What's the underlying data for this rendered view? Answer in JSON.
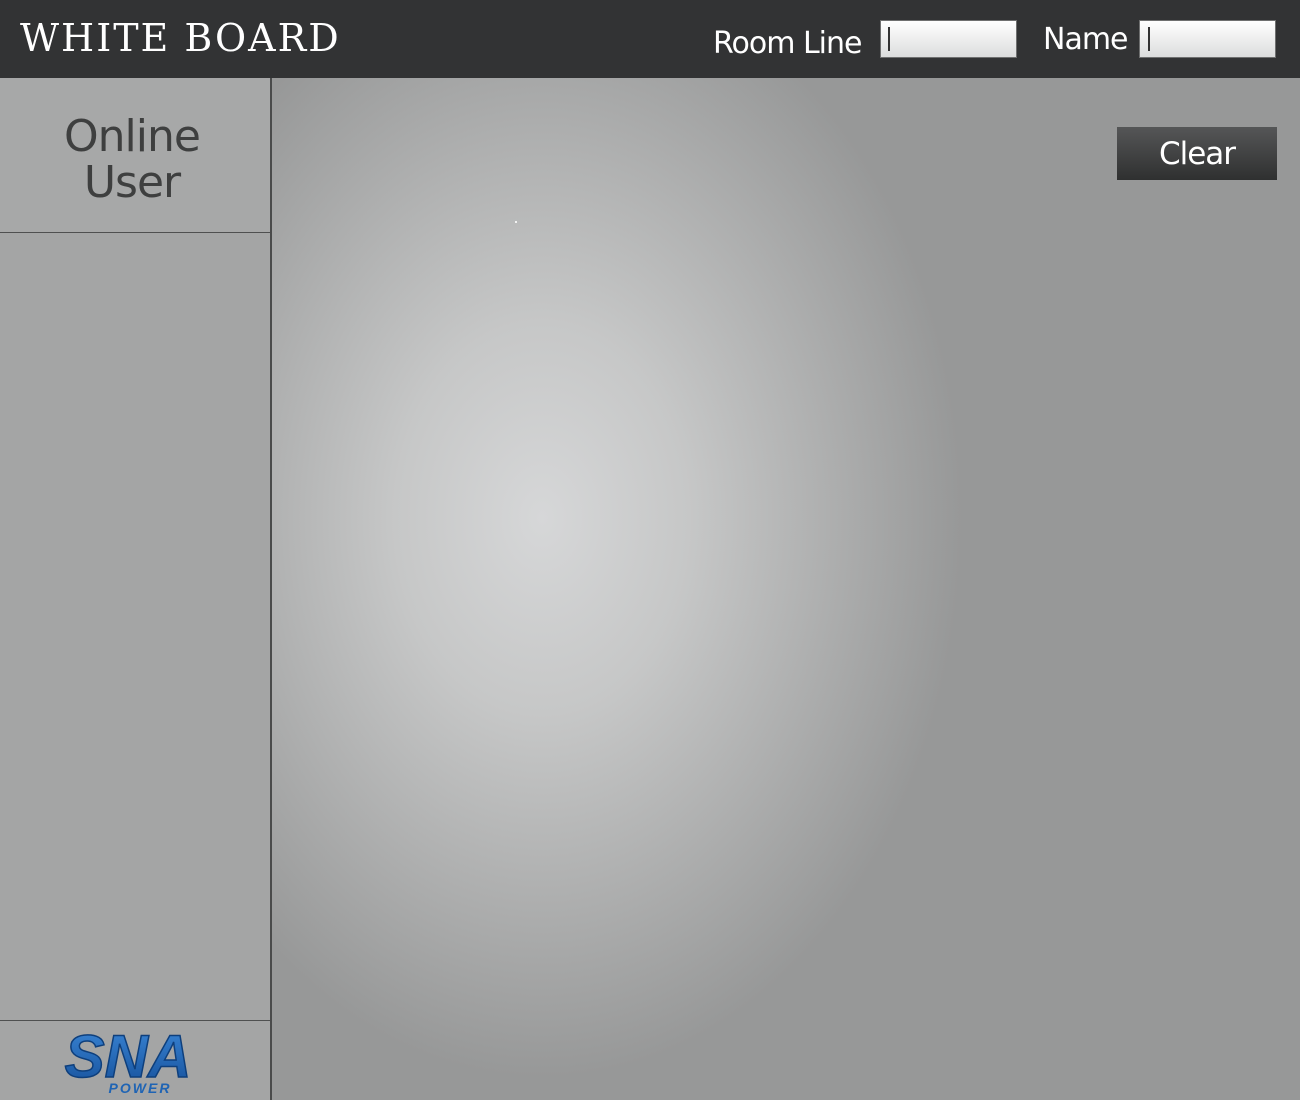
{
  "header": {
    "title": "WHITE BOARD",
    "room_label": "Room Line",
    "room_value": "",
    "name_label": "Name",
    "name_value": ""
  },
  "sidebar": {
    "title_line1": "Online",
    "title_line2": "User",
    "users": [],
    "logo": {
      "main_text": "SNA",
      "sub_text": "POWER",
      "color": "#1f64b4"
    }
  },
  "board": {
    "clear_label": "Clear"
  },
  "colors": {
    "header_bg": "#323334",
    "sidebar_bg": "#a4a5a5",
    "button_bg": "#3f4040",
    "logo_blue": "#1f64b4"
  }
}
